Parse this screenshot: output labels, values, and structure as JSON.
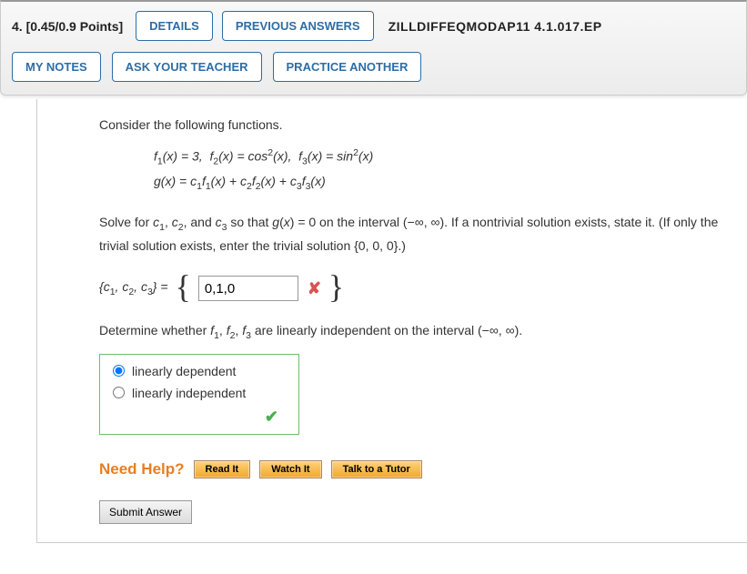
{
  "header": {
    "points_label": "4.  [0.45/0.9 Points]",
    "details": "DETAILS",
    "previous_answers": "PREVIOUS ANSWERS",
    "source": "ZILLDIFFEQMODAP11 4.1.017.EP",
    "my_notes": "MY NOTES",
    "ask_teacher": "ASK YOUR TEACHER",
    "practice_another": "PRACTICE ANOTHER"
  },
  "problem": {
    "intro": "Consider the following functions.",
    "math_line1_plain": "f1(x) = 3,  f2(x) = cos^2(x),  f3(x) = sin^2(x)",
    "math_line2_plain": "g(x) = c1 f1(x) + c2 f2(x) + c3 f3(x)",
    "solve_text": "Solve for c₁, c₂, and c₃ so that g(x) = 0 on the interval (−∞, ∞). If a nontrivial solution exists, state it. (If only the trivial solution exists, enter the trivial solution {0, 0, 0}.)",
    "tuple_label": "{c₁, c₂, c₃} =",
    "answer_value": "0,1,0",
    "answer_correct": false,
    "determine_text": "Determine whether f₁, f₂, f₃ are linearly independent on the interval (−∞, ∞).",
    "radio_options": {
      "dependent": "linearly dependent",
      "independent": "linearly independent"
    },
    "radio_selected": "dependent",
    "radio_correct": true
  },
  "help": {
    "label": "Need Help?",
    "read": "Read It",
    "watch": "Watch It",
    "tutor": "Talk to a Tutor"
  },
  "submit": "Submit Answer"
}
